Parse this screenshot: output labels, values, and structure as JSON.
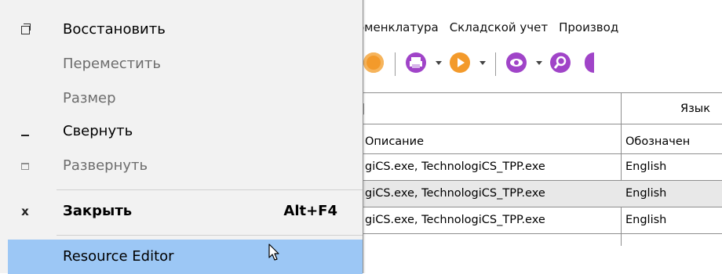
{
  "menubar": [
    "оменклатура",
    "Складской учет",
    "Производ"
  ],
  "toolbar": {
    "icons": [
      "refresh-icon",
      "printer-icon",
      "play-icon",
      "eye-icon",
      "zoom-icon"
    ],
    "colors": {
      "orange": "#f39a2b",
      "purple": "#a044c8"
    }
  },
  "grid": {
    "group_header": "Язык",
    "columns": [
      "Описание",
      "Обозначен"
    ],
    "rows": [
      {
        "description": "giCS.exe, TechnologiCS_TPP.exe",
        "designation": "English"
      },
      {
        "description": "giCS.exe, TechnologiCS_TPP.exe",
        "designation": "English"
      },
      {
        "description": "giCS.exe, TechnologiCS_TPP.exe",
        "designation": "English"
      }
    ]
  },
  "context_menu": {
    "restore": "Восстановить",
    "move": "Переместить",
    "size": "Размер",
    "minimize": "Свернуть",
    "maximize": "Развернуть",
    "close": "Закрыть",
    "close_shortcut": "Alt+F4",
    "resource_editor": "Resource Editor",
    "colors": {
      "menu_bg": "#f2f2f2",
      "highlight": "#9cc7f5",
      "disabled_text": "#6d6d6d"
    }
  }
}
